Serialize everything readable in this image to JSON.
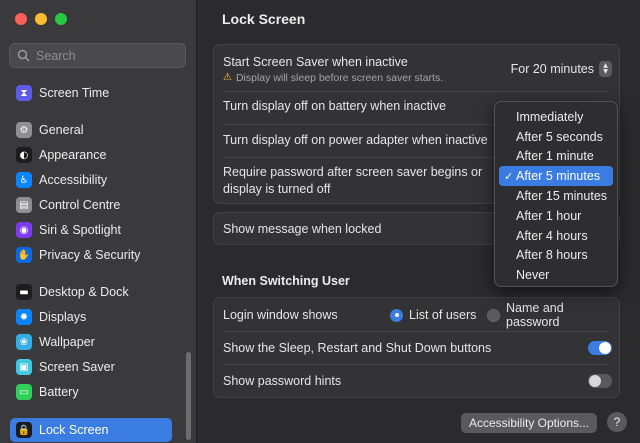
{
  "window": {
    "title": "Lock Screen"
  },
  "sidebar": {
    "search_placeholder": "Search",
    "items": [
      {
        "label": "Screen Time",
        "icon": "hourglass-icon",
        "color": "#5e5ce6",
        "glyph": "⧗"
      },
      {
        "label": "General",
        "icon": "gear-icon",
        "color": "#8e8e93",
        "glyph": "⚙"
      },
      {
        "label": "Appearance",
        "icon": "appearance-icon",
        "color": "#1c1c1e",
        "glyph": "◐"
      },
      {
        "label": "Accessibility",
        "icon": "accessibility-icon",
        "color": "#0a84ff",
        "glyph": "♿"
      },
      {
        "label": "Control Centre",
        "icon": "control-centre-icon",
        "color": "#8e8e93",
        "glyph": "▤"
      },
      {
        "label": "Siri & Spotlight",
        "icon": "siri-icon",
        "color": "#7d3cf0",
        "glyph": "◉"
      },
      {
        "label": "Privacy & Security",
        "icon": "hand-icon",
        "color": "#0a6ae6",
        "glyph": "✋"
      },
      {
        "label": "Desktop & Dock",
        "icon": "dock-icon",
        "color": "#1c1c1e",
        "glyph": "▬"
      },
      {
        "label": "Displays",
        "icon": "displays-icon",
        "color": "#0a84ff",
        "glyph": "✹"
      },
      {
        "label": "Wallpaper",
        "icon": "wallpaper-icon",
        "color": "#32ade6",
        "glyph": "❀"
      },
      {
        "label": "Screen Saver",
        "icon": "screen-saver-icon",
        "color": "#40c8e0",
        "glyph": "▣"
      },
      {
        "label": "Battery",
        "icon": "battery-icon",
        "color": "#30d158",
        "glyph": "▭"
      },
      {
        "label": "Lock Screen",
        "icon": "lock-icon",
        "color": "#1c1c1e",
        "glyph": "🔒"
      }
    ],
    "active_index": 12
  },
  "main": {
    "title": "Lock Screen",
    "screen_saver": {
      "label": "Start Screen Saver when inactive",
      "warning": "Display will sleep before screen saver starts.",
      "value": "For 20 minutes"
    },
    "display_off_battery": {
      "label": "Turn display off on battery when inactive"
    },
    "display_off_adapter": {
      "label": "Turn display off on power adapter when inactive"
    },
    "require_password": {
      "label_line1": "Require password after screen saver begins or",
      "label_line2": "display is turned off"
    },
    "show_message": {
      "label": "Show message when locked"
    },
    "switching_title": "When Switching User",
    "login_window": {
      "label": "Login window shows",
      "option1": "List of users",
      "option2": "Name and password",
      "selected": "List of users"
    },
    "sleep_buttons": {
      "label": "Show the Sleep, Restart and Shut Down buttons",
      "on": true
    },
    "password_hints": {
      "label": "Show password hints",
      "on": false
    },
    "accessibility_button": "Accessibility Options...",
    "help_button": "?"
  },
  "dropdown": {
    "options": [
      "Immediately",
      "After 5 seconds",
      "After 1 minute",
      "After 5 minutes",
      "After 15 minutes",
      "After 1 hour",
      "After 4 hours",
      "After 8 hours",
      "Never"
    ],
    "selected": "After 5 minutes",
    "check": "✓"
  },
  "colors": {
    "accent": "#3b7ce2",
    "warning": "#f5c542"
  }
}
